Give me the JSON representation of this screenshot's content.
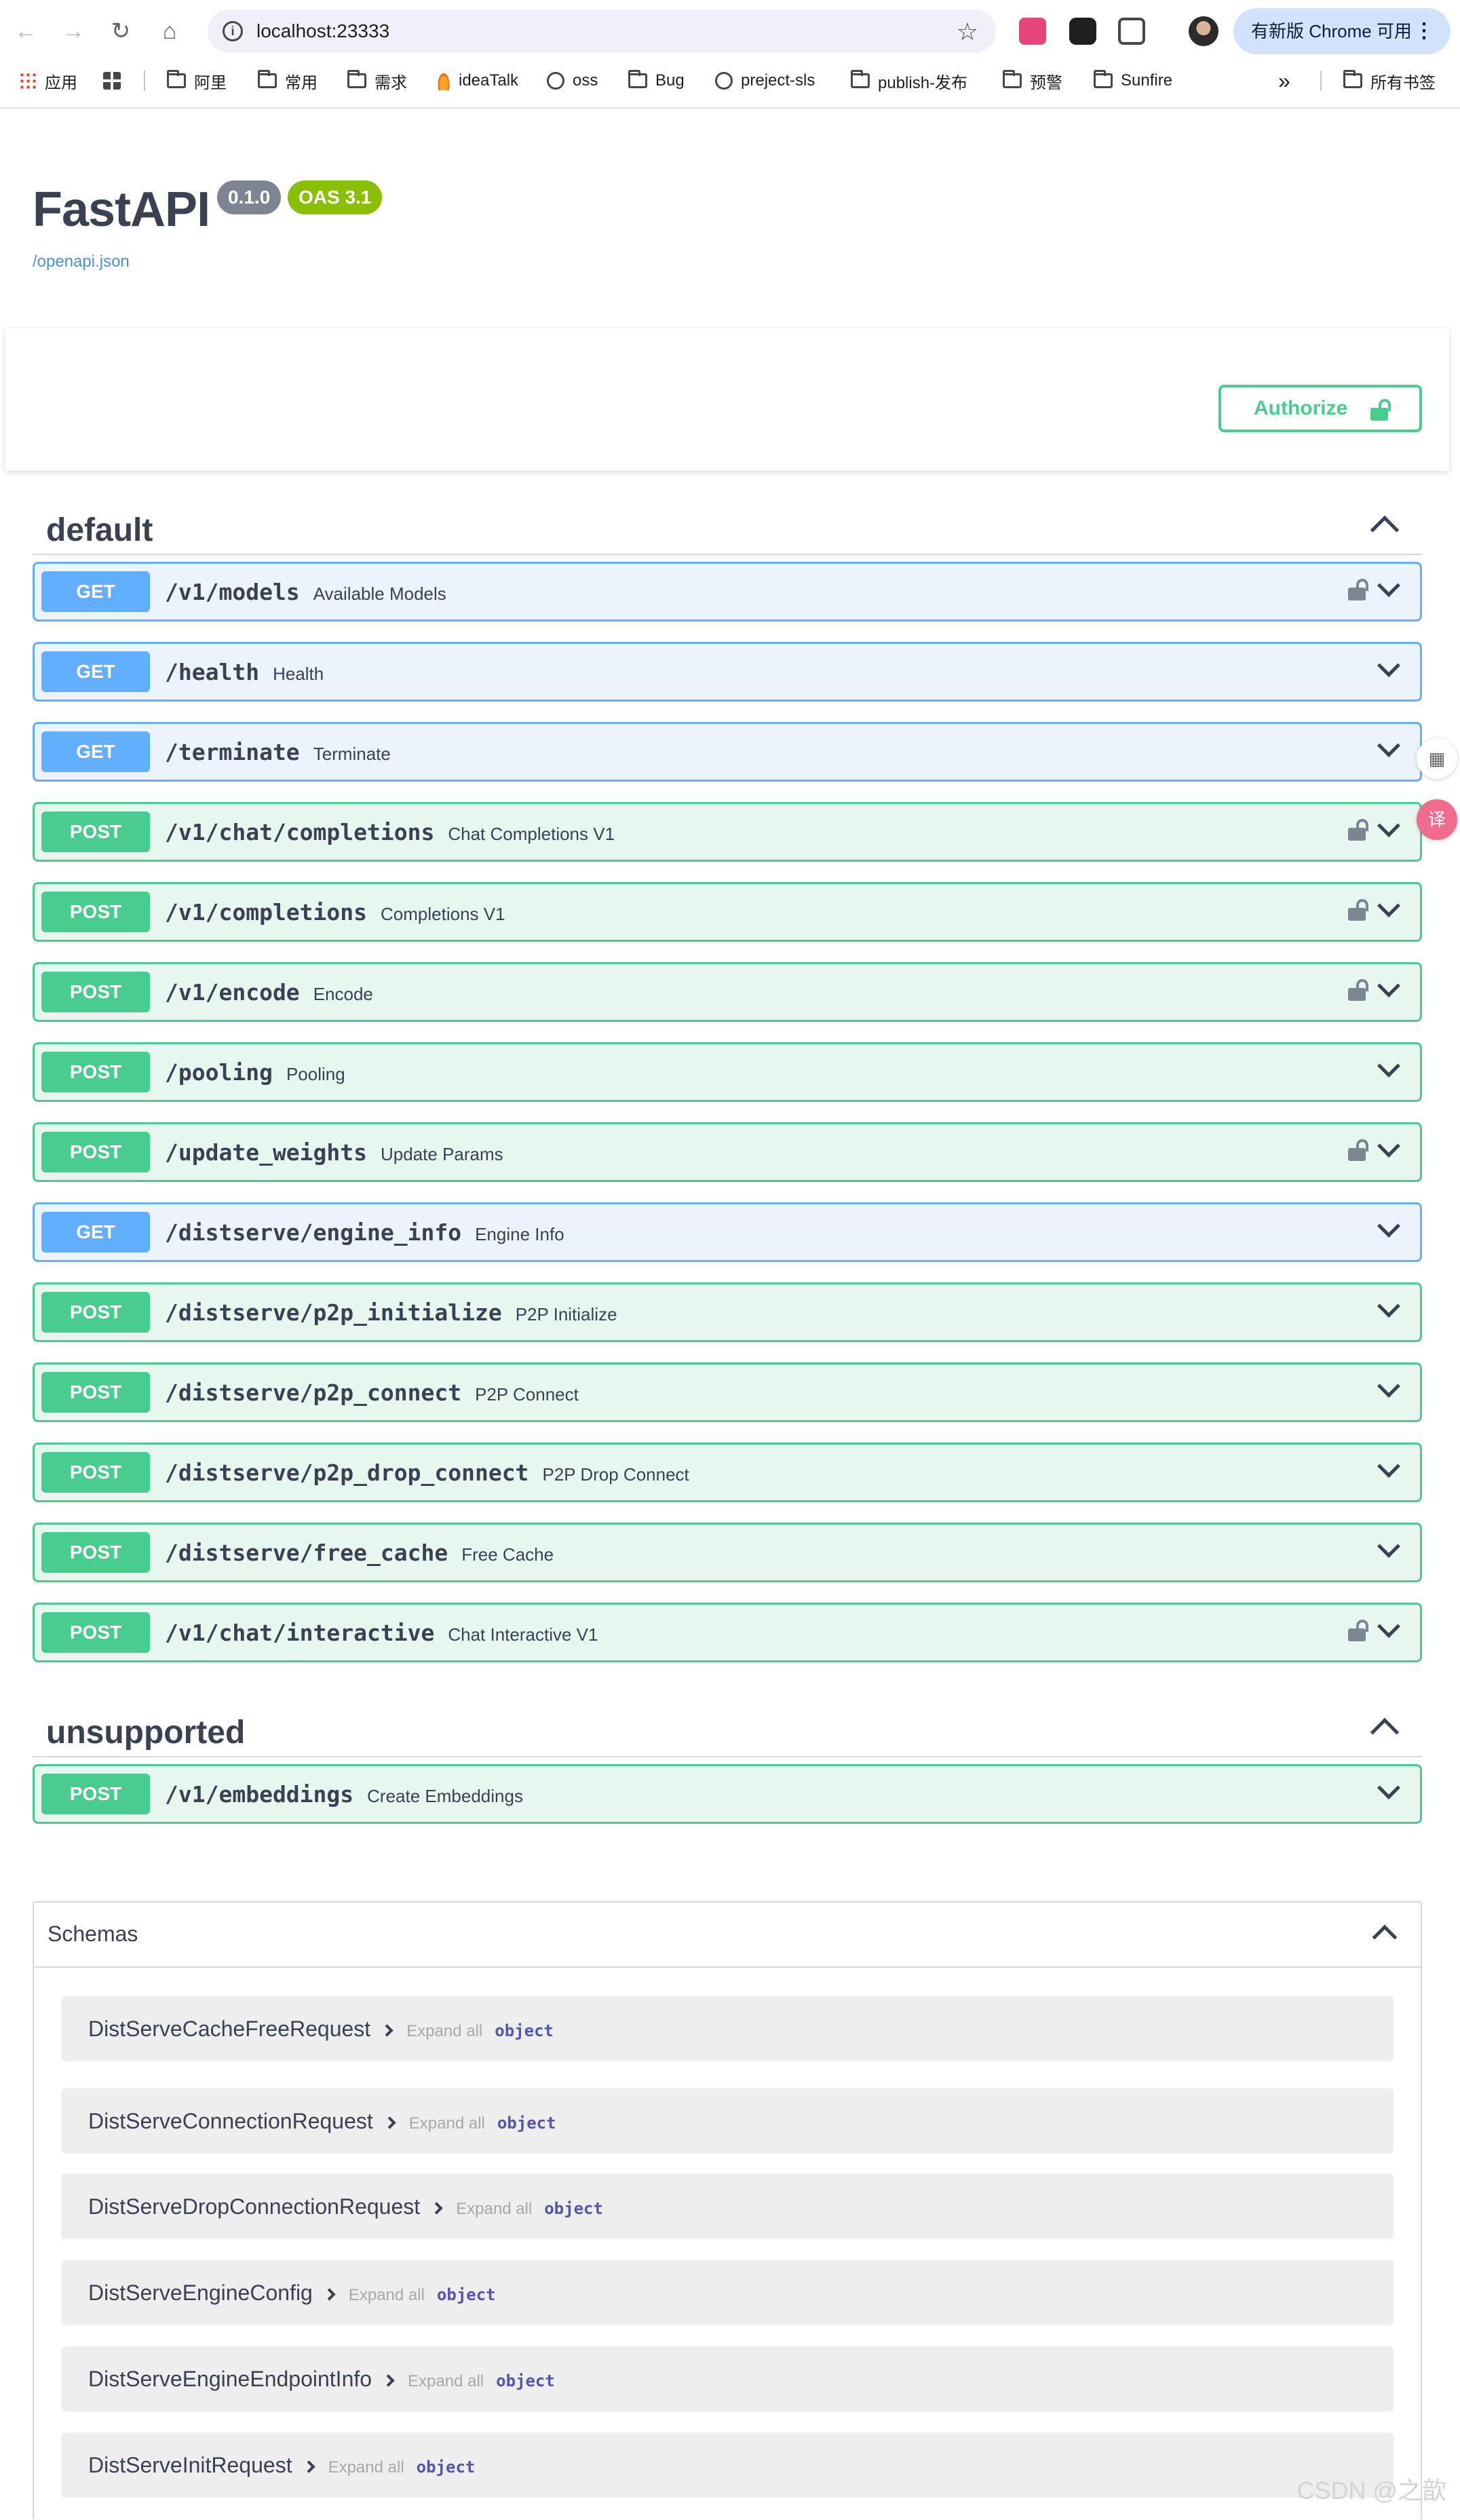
{
  "browser": {
    "url": "localhost:23333",
    "update_label": "有新版 Chrome 可用",
    "bookmarks": [
      {
        "label": "应用",
        "icon": "apps-grid-icon"
      },
      {
        "label": "",
        "icon": "tab-groups-icon"
      },
      {
        "label": "阿里",
        "icon": "folder-icon"
      },
      {
        "label": "常用",
        "icon": "folder-icon"
      },
      {
        "label": "需求",
        "icon": "folder-icon"
      },
      {
        "label": "ideaTalk",
        "icon": "flame-icon"
      },
      {
        "label": "oss",
        "icon": "globe-icon"
      },
      {
        "label": "Bug",
        "icon": "folder-icon"
      },
      {
        "label": "preject-sls",
        "icon": "globe-icon"
      },
      {
        "label": "publish-发布",
        "icon": "folder-icon"
      },
      {
        "label": "预警",
        "icon": "folder-icon"
      },
      {
        "label": "Sunfire",
        "icon": "folder-icon"
      }
    ],
    "overflow_label": "»",
    "all_bookmarks_label": "所有书签"
  },
  "app": {
    "title": "FastAPI",
    "version": "0.1.0",
    "oas": "OAS 3.1",
    "spec_link": "/openapi.json",
    "authorize_label": "Authorize"
  },
  "tags": [
    {
      "name": "default",
      "operations": [
        {
          "method": "GET",
          "path": "/v1/models",
          "summary": "Available Models",
          "locked": true
        },
        {
          "method": "GET",
          "path": "/health",
          "summary": "Health",
          "locked": false
        },
        {
          "method": "GET",
          "path": "/terminate",
          "summary": "Terminate",
          "locked": false
        },
        {
          "method": "POST",
          "path": "/v1/chat/completions",
          "summary": "Chat Completions V1",
          "locked": true
        },
        {
          "method": "POST",
          "path": "/v1/completions",
          "summary": "Completions V1",
          "locked": true
        },
        {
          "method": "POST",
          "path": "/v1/encode",
          "summary": "Encode",
          "locked": true
        },
        {
          "method": "POST",
          "path": "/pooling",
          "summary": "Pooling",
          "locked": false
        },
        {
          "method": "POST",
          "path": "/update_weights",
          "summary": "Update Params",
          "locked": true
        },
        {
          "method": "GET",
          "path": "/distserve/engine_info",
          "summary": "Engine Info",
          "locked": false
        },
        {
          "method": "POST",
          "path": "/distserve/p2p_initialize",
          "summary": "P2P Initialize",
          "locked": false
        },
        {
          "method": "POST",
          "path": "/distserve/p2p_connect",
          "summary": "P2P Connect",
          "locked": false
        },
        {
          "method": "POST",
          "path": "/distserve/p2p_drop_connect",
          "summary": "P2P Drop Connect",
          "locked": false
        },
        {
          "method": "POST",
          "path": "/distserve/free_cache",
          "summary": "Free Cache",
          "locked": false
        },
        {
          "method": "POST",
          "path": "/v1/chat/interactive",
          "summary": "Chat Interactive V1",
          "locked": true
        }
      ]
    },
    {
      "name": "unsupported",
      "operations": [
        {
          "method": "POST",
          "path": "/v1/embeddings",
          "summary": "Create Embeddings",
          "locked": false
        }
      ]
    }
  ],
  "schemas": {
    "title": "Schemas",
    "expand_label": "Expand all",
    "items": [
      {
        "name": "DistServeCacheFreeRequest",
        "type": "object"
      },
      {
        "name": "DistServeConnectionRequest",
        "type": "object"
      },
      {
        "name": "DistServeDropConnectionRequest",
        "type": "object"
      },
      {
        "name": "DistServeEngineConfig",
        "type": "object"
      },
      {
        "name": "DistServeEngineEndpointInfo",
        "type": "object"
      },
      {
        "name": "DistServeInitRequest",
        "type": "object"
      }
    ]
  },
  "side_tools": {
    "qr_icon": "qr-code-icon",
    "translate_label": "译"
  },
  "watermark": "CSDN @之歆",
  "colors": {
    "get": "#61affe",
    "post": "#49cc90",
    "authorize": "#49cc90",
    "oas_badge": "#89bf04",
    "version_badge": "#7d8492"
  }
}
